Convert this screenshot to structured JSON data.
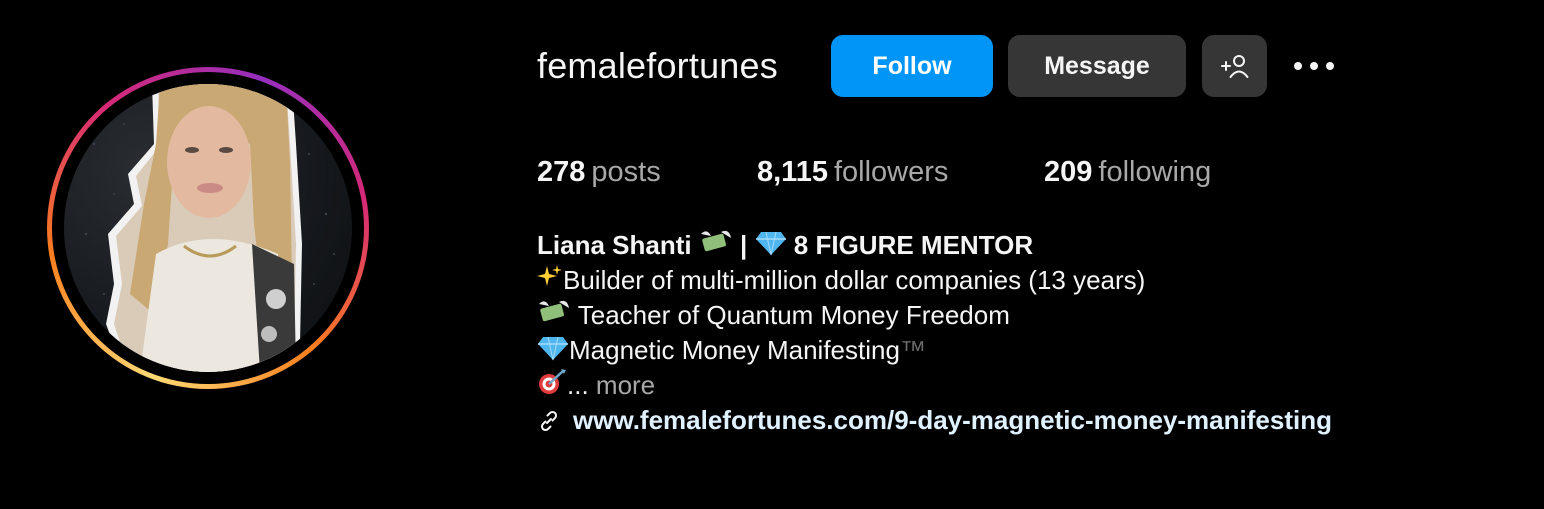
{
  "profile": {
    "username": "femalefortunes",
    "follow_label": "Follow",
    "message_label": "Message",
    "add_user_icon": "add-user-icon",
    "more_icon": "more-options-icon"
  },
  "stats": {
    "posts_count": "278",
    "posts_label": "posts",
    "followers_count": "8,115",
    "followers_label": "followers",
    "following_count": "209",
    "following_label": "following"
  },
  "bio": {
    "name": "Liana Shanti",
    "name_separator": "|",
    "headline": "8 FIGURE MENTOR",
    "line1": "Builder of multi-million dollar companies (13 years)",
    "line2": "Teacher of Quantum Money Freedom",
    "line3": "Magnetic Money Manifesting",
    "line3_tm": "™",
    "line4_ellipsis": "...",
    "more_label": "more",
    "link_icon": "link-icon",
    "link_url": "www.femalefortunes.com/9-day-magnetic-money-manifesting"
  },
  "colors": {
    "background": "#000000",
    "follow_button": "#0095f6",
    "secondary_button": "#363636",
    "muted_text": "#a8a8a8",
    "link_text": "#e0f1ff"
  }
}
